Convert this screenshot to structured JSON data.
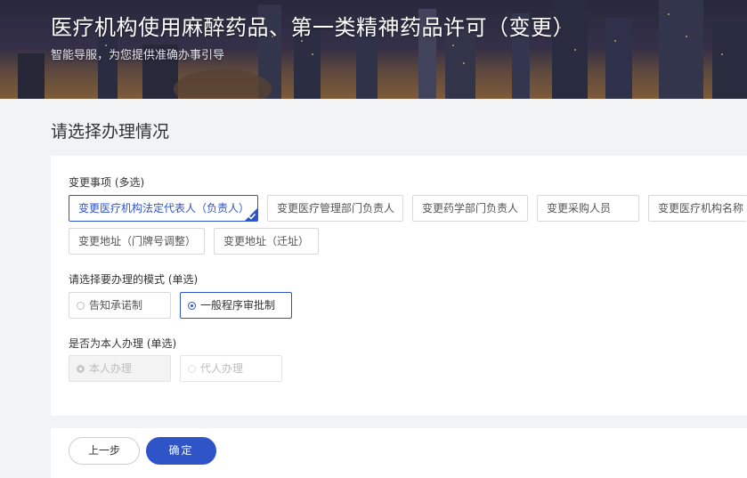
{
  "banner": {
    "title": "医疗机构使用麻醉药品、第一类精神药品许可（变更）",
    "subtitle": "智能导服，为您提供准确办事引导"
  },
  "section_title": "请选择办理情况",
  "change_items": {
    "label": "变更事项 (多选)",
    "options": [
      {
        "label": "变更医疗机构法定代表人（负责人）",
        "selected": true
      },
      {
        "label": "变更医疗管理部门负责人",
        "selected": false
      },
      {
        "label": "变更药学部门负责人",
        "selected": false
      },
      {
        "label": "变更采购人员",
        "selected": false
      },
      {
        "label": "变更医疗机构名称",
        "selected": false
      },
      {
        "label": "变更地址（门牌号调整）",
        "selected": false
      },
      {
        "label": "变更地址（迁址）",
        "selected": false
      }
    ]
  },
  "mode": {
    "label": "请选择要办理的模式 (单选)",
    "options": [
      {
        "label": "告知承诺制",
        "selected": false
      },
      {
        "label": "一般程序审批制",
        "selected": true
      }
    ]
  },
  "self_handle": {
    "label": "是否为本人办理 (单选)",
    "options": [
      {
        "label": "本人办理",
        "selected": true,
        "disabled": true
      },
      {
        "label": "代人办理",
        "selected": false,
        "disabled": true
      }
    ]
  },
  "buttons": {
    "prev": "上一步",
    "confirm": "确定"
  },
  "colors": {
    "accent": "#2f54c8",
    "page_background": "#f2f3f5"
  },
  "icons": [
    "check-icon",
    "radio-icon"
  ]
}
